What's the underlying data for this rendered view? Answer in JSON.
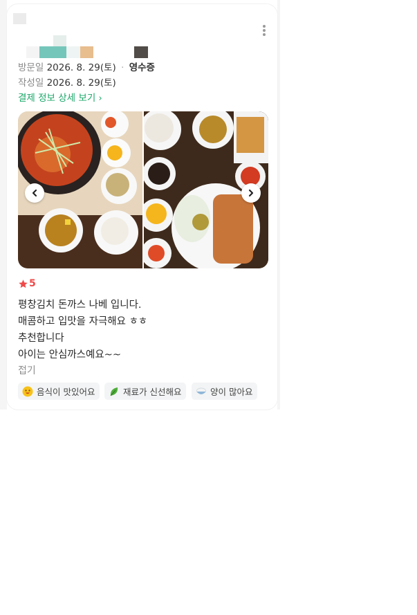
{
  "visit": {
    "label": "방문일",
    "date": "2026. 8. 29(토)",
    "separator": "·",
    "receipt": "영수증"
  },
  "written": {
    "label": "작성일",
    "date": "2026. 8. 29(토)"
  },
  "payment_link": "결제 정보 상세 보기",
  "rating": "5",
  "review_lines": [
    "평창김치 돈까스 나베 입니다.",
    "매콤하고 입맛을 자극해요 ㅎㅎ",
    "추천합니다",
    "아이는 안심까스예요~~"
  ],
  "fold_label": "접기",
  "tags": [
    {
      "label": "음식이 맛있어요",
      "icon": "smiley-face-icon"
    },
    {
      "label": "재료가 신선해요",
      "icon": "leaf-icon"
    },
    {
      "label": "양이 많아요",
      "icon": "rice-bowl-icon"
    }
  ],
  "colors": {
    "accent_green": "#1ca76a",
    "star_red": "#ef4a4a",
    "tag_bg": "#f3f4f5"
  }
}
